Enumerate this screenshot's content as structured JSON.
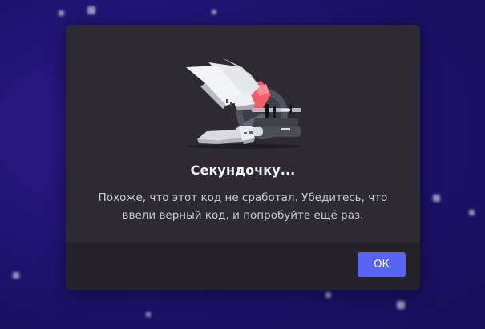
{
  "dialog": {
    "title": "Секундочку...",
    "message": "Похоже, что этот код не сработал. Убедитесь, что ввели верный код, и попробуйте ещё раз.",
    "ok_label": "ОК"
  },
  "illustration": {
    "icon": "broken-robot-arm-saw-icon"
  },
  "colors": {
    "background": "#1b1166",
    "modal": "#2e2a33",
    "footer": "#26222b",
    "button": "#5865f2",
    "accent_red": "#f25f6a"
  }
}
